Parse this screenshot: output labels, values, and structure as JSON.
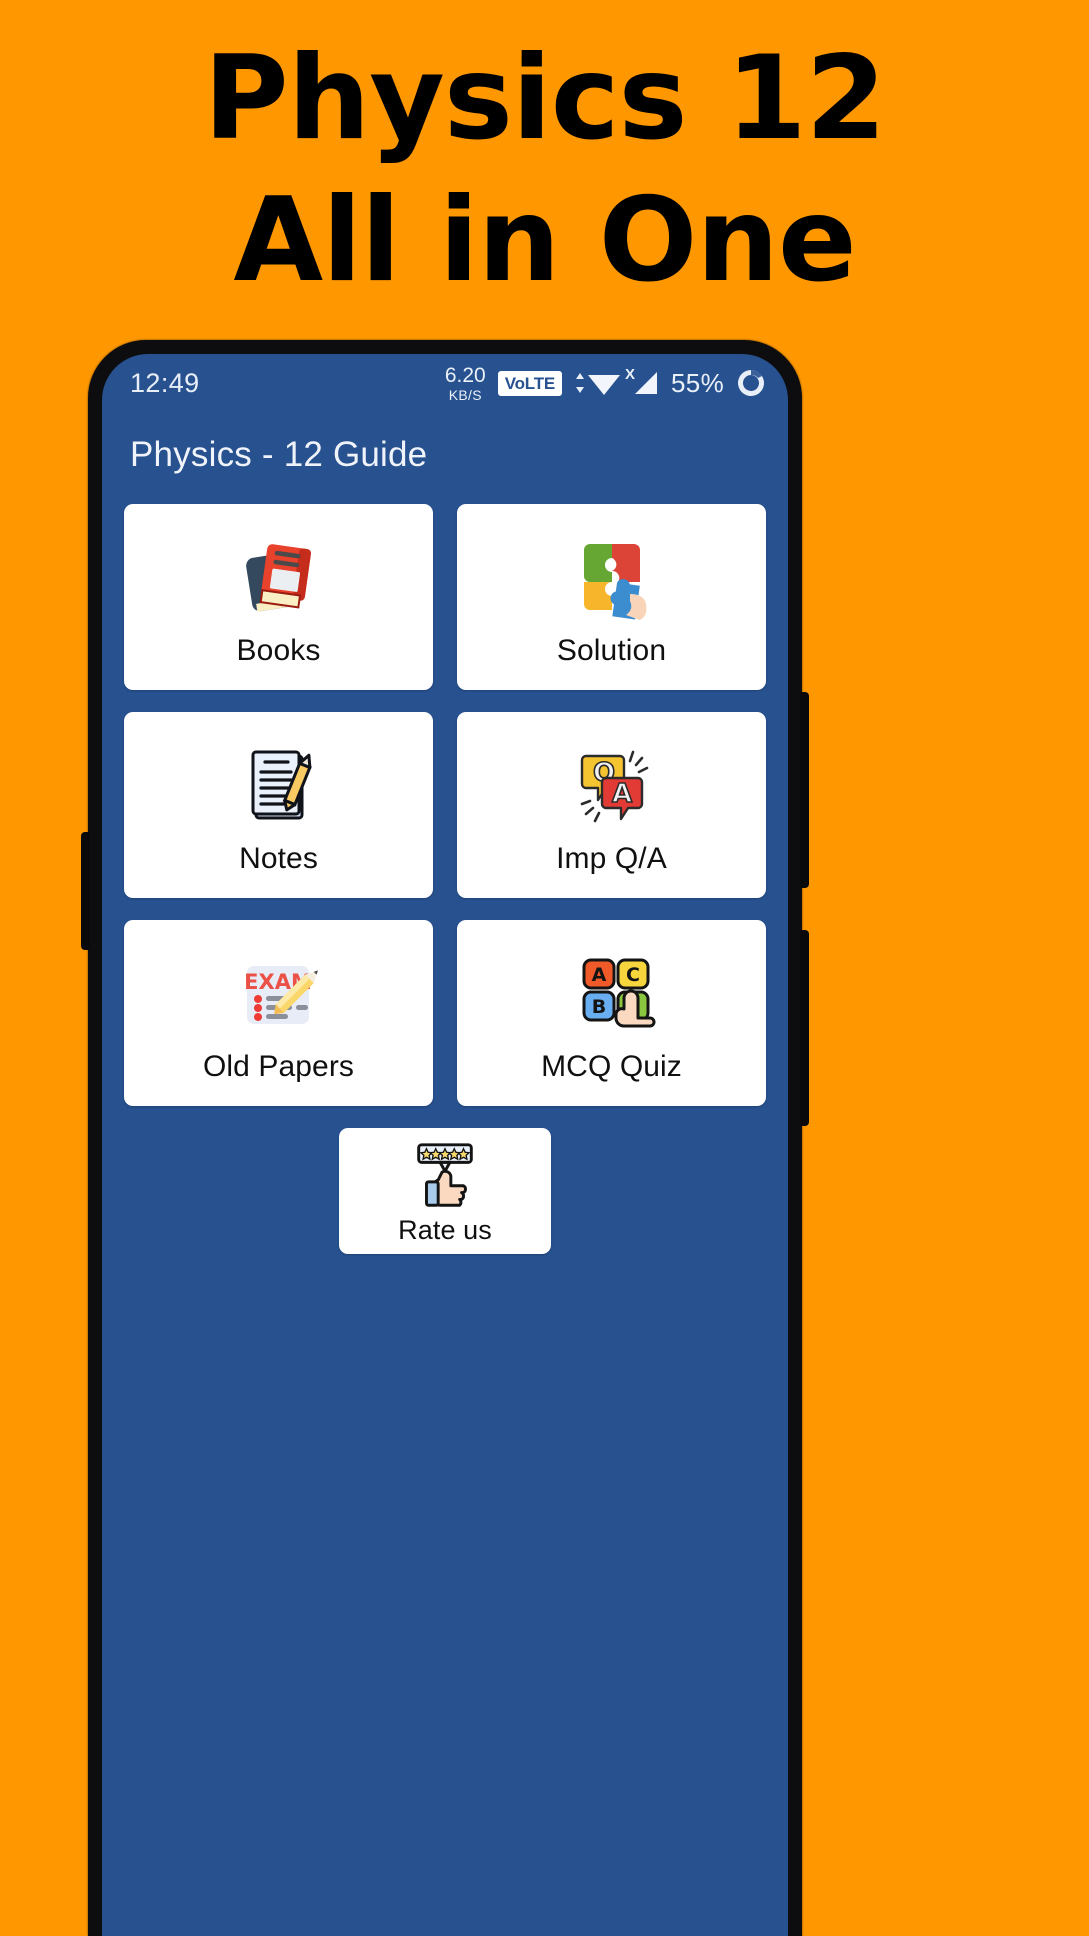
{
  "promo": {
    "line1": "Physics 12",
    "line2": "All in One",
    "background_color": "#FF9800",
    "text_color": "#000000"
  },
  "device": {
    "frame_color": "#0d0d0f",
    "screen_background": "#27518F"
  },
  "status_bar": {
    "clock": "12:49",
    "net_speed_value": "6.20",
    "net_speed_unit": "KB/S",
    "volte_label": "VoLTE",
    "wifi_icon": "wifi-icon",
    "signal_icon": "signal-bars-icon",
    "signal_badge": "X",
    "battery_percent": "55%",
    "battery_icon": "battery-circle-icon"
  },
  "app_bar": {
    "title": "Physics - 12 Guide"
  },
  "grid": {
    "items": [
      {
        "label": "Books",
        "icon": "books-icon"
      },
      {
        "label": "Solution",
        "icon": "puzzle-hand-icon"
      },
      {
        "label": "Notes",
        "icon": "notepad-pencil-icon"
      },
      {
        "label": "Imp Q/A",
        "icon": "qa-speech-bubbles-icon"
      },
      {
        "label": "Old Papers",
        "icon": "exam-paper-pencil-icon"
      },
      {
        "label": "MCQ Quiz",
        "icon": "abcd-tiles-hand-icon"
      }
    ]
  },
  "rate": {
    "label": "Rate us",
    "icon": "thumbs-up-stars-icon",
    "stars": 5
  },
  "colors": {
    "card_background": "#FFFFFF",
    "card_label": "#101010",
    "app_bar_text": "#F0F4FA",
    "accent_orange": "#FF9800",
    "accent_blue": "#27518F"
  }
}
